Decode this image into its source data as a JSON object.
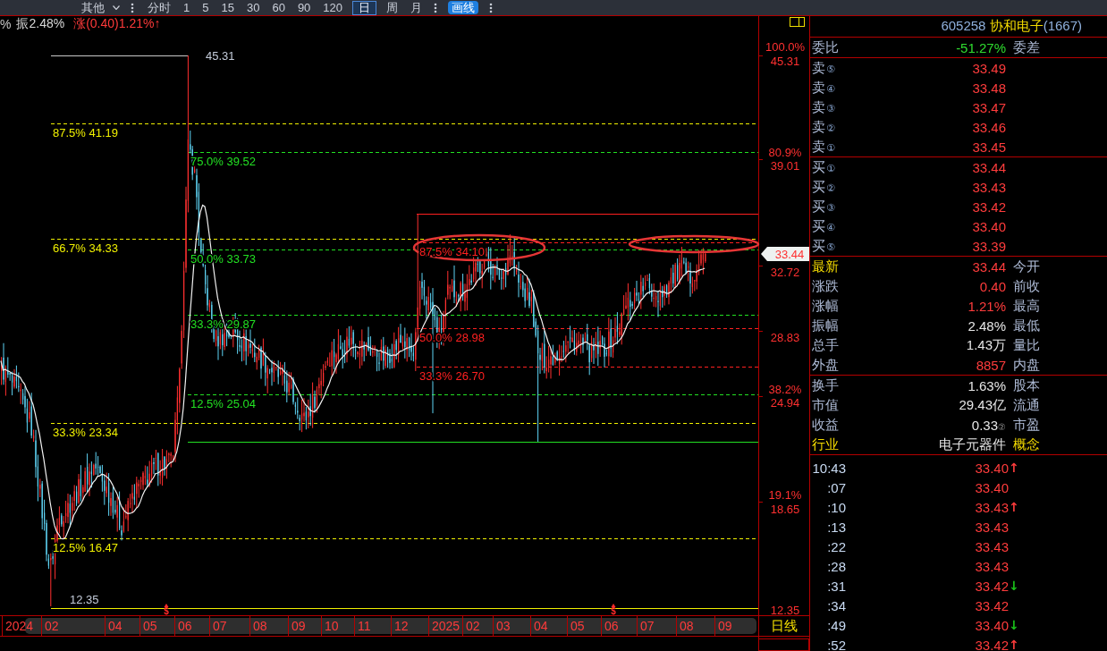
{
  "toolbar": {
    "menus": [
      {
        "label": "其他",
        "kind": "dropdown"
      }
    ],
    "periods": [
      {
        "label": "分时",
        "selected": false
      },
      {
        "label": "1",
        "selected": false
      },
      {
        "label": "5",
        "selected": false
      },
      {
        "label": "15",
        "selected": false
      },
      {
        "label": "30",
        "selected": false
      },
      {
        "label": "60",
        "selected": false
      },
      {
        "label": "90",
        "selected": false
      },
      {
        "label": "120",
        "selected": false
      },
      {
        "label": "日",
        "selected": true
      },
      {
        "label": "周",
        "selected": false
      },
      {
        "label": "月",
        "selected": false
      }
    ],
    "draw_button": "画线"
  },
  "quote_line": {
    "lead": "%",
    "amplitude": "振2.48%",
    "change": "涨(0.40)1.21%↑"
  },
  "chart": {
    "high_label": "45.31",
    "low_label": "12.35",
    "fib_sets": [
      {
        "color": "#f0f000",
        "levels": [
          "87.5% 41.19",
          "66.7% 34.33",
          "33.3% 23.34",
          "12.5% 16.47"
        ]
      },
      {
        "color": "#22e022",
        "levels": [
          "75.0% 39.52",
          "50.0% 33.73",
          "33.3% 29.87",
          "12.5% 25.04"
        ]
      },
      {
        "color": "#ff2020",
        "levels": [
          "87.5% 34.10",
          "50.0% 28.98",
          "33.3% 26.70"
        ]
      }
    ],
    "markers": [
      "$",
      "$"
    ],
    "price_axis": [
      {
        "kind": "level",
        "percent": "100.0%",
        "price": "45.31"
      },
      {
        "kind": "level",
        "percent": "80.9%",
        "price": "39.01"
      },
      {
        "kind": "current",
        "price": "33.44"
      },
      {
        "kind": "price",
        "price": "32.72"
      },
      {
        "kind": "price",
        "price": "28.83"
      },
      {
        "kind": "level",
        "percent": "38.2%",
        "price": "24.94"
      },
      {
        "kind": "level",
        "percent": "19.1%",
        "price": "18.65"
      },
      {
        "kind": "price",
        "price": "12.35"
      }
    ],
    "x_axis": [
      "2024",
      "02",
      "04",
      "05",
      "06",
      "07",
      "08",
      "09",
      "10",
      "11",
      "12",
      "2025",
      "02",
      "03",
      "04",
      "05",
      "06",
      "07",
      "08",
      "09"
    ],
    "period_label": "日线"
  },
  "quote_panel": {
    "code": "605258",
    "name": "协和电子",
    "count": "(1667)",
    "order_ratio": {
      "label": "委比",
      "value": "-51.27%",
      "color": "#2fdc2f",
      "label2": "委差"
    },
    "asks": [
      {
        "label": "卖",
        "rank": "⑤",
        "price": "33.49"
      },
      {
        "label": "卖",
        "rank": "④",
        "price": "33.48"
      },
      {
        "label": "卖",
        "rank": "③",
        "price": "33.47"
      },
      {
        "label": "卖",
        "rank": "②",
        "price": "33.46"
      },
      {
        "label": "卖",
        "rank": "①",
        "price": "33.45"
      }
    ],
    "bids": [
      {
        "label": "买",
        "rank": "①",
        "price": "33.44"
      },
      {
        "label": "买",
        "rank": "②",
        "price": "33.43"
      },
      {
        "label": "买",
        "rank": "③",
        "price": "33.42"
      },
      {
        "label": "买",
        "rank": "④",
        "price": "33.40"
      },
      {
        "label": "买",
        "rank": "⑤",
        "price": "33.39"
      }
    ],
    "stats": [
      {
        "label": "最新",
        "highlight": true,
        "value": "33.44",
        "color": "#ff3c3c",
        "label2": "今开"
      },
      {
        "label": "涨跌",
        "highlight": false,
        "value": "0.40",
        "color": "#ff3c3c",
        "label2": "前收"
      },
      {
        "label": "涨幅",
        "highlight": false,
        "value": "1.21%",
        "color": "#ff3c3c",
        "label2": "最高"
      },
      {
        "label": "振幅",
        "highlight": false,
        "value": "2.48%",
        "color": "#e6e6e6",
        "label2": "最低"
      },
      {
        "label": "总手",
        "highlight": false,
        "value": "1.43万",
        "color": "#e6e6e6",
        "label2": "量比"
      },
      {
        "label": "外盘",
        "highlight": false,
        "value": "8857",
        "color": "#ff3c3c",
        "label2": "内盘"
      }
    ],
    "fundamentals": [
      {
        "label": "换手",
        "highlight": false,
        "value": "1.63%",
        "color": "#e6e6e6",
        "label2": "股本",
        "label2_highlight": false
      },
      {
        "label": "市值",
        "highlight": false,
        "value": "29.43亿",
        "color": "#e6e6e6",
        "label2": "流通",
        "label2_highlight": false
      },
      {
        "label": "收益",
        "highlight": false,
        "value": "0.33",
        "note": "②",
        "color": "#e6e6e6",
        "label2": "市盈",
        "label2_highlight": false
      },
      {
        "label": "行业",
        "highlight": true,
        "value": "电子元器件",
        "color": "#e6e6e6",
        "label2": "概念",
        "label2_highlight": true
      }
    ],
    "ticks": [
      {
        "time": "10:43",
        "price": "33.40",
        "arrow": {
          "text": "↑",
          "color": "#ff3c3c"
        }
      },
      {
        "time": ":07",
        "price": "33.40"
      },
      {
        "time": ":10",
        "price": "33.43",
        "arrow": {
          "text": "↑",
          "color": "#ff3c3c"
        }
      },
      {
        "time": ":13",
        "price": "33.43"
      },
      {
        "time": ":22",
        "price": "33.43"
      },
      {
        "time": ":28",
        "price": "33.43"
      },
      {
        "time": ":31",
        "price": "33.42",
        "arrow": {
          "text": "↓",
          "color": "#19c019"
        }
      },
      {
        "time": ":34",
        "price": "33.42"
      },
      {
        "time": ":49",
        "price": "33.40",
        "arrow": {
          "text": "↓",
          "color": "#19c019"
        }
      },
      {
        "time": ":52",
        "price": "33.42",
        "arrow": {
          "text": "↑",
          "color": "#ff3c3c"
        }
      }
    ]
  }
}
